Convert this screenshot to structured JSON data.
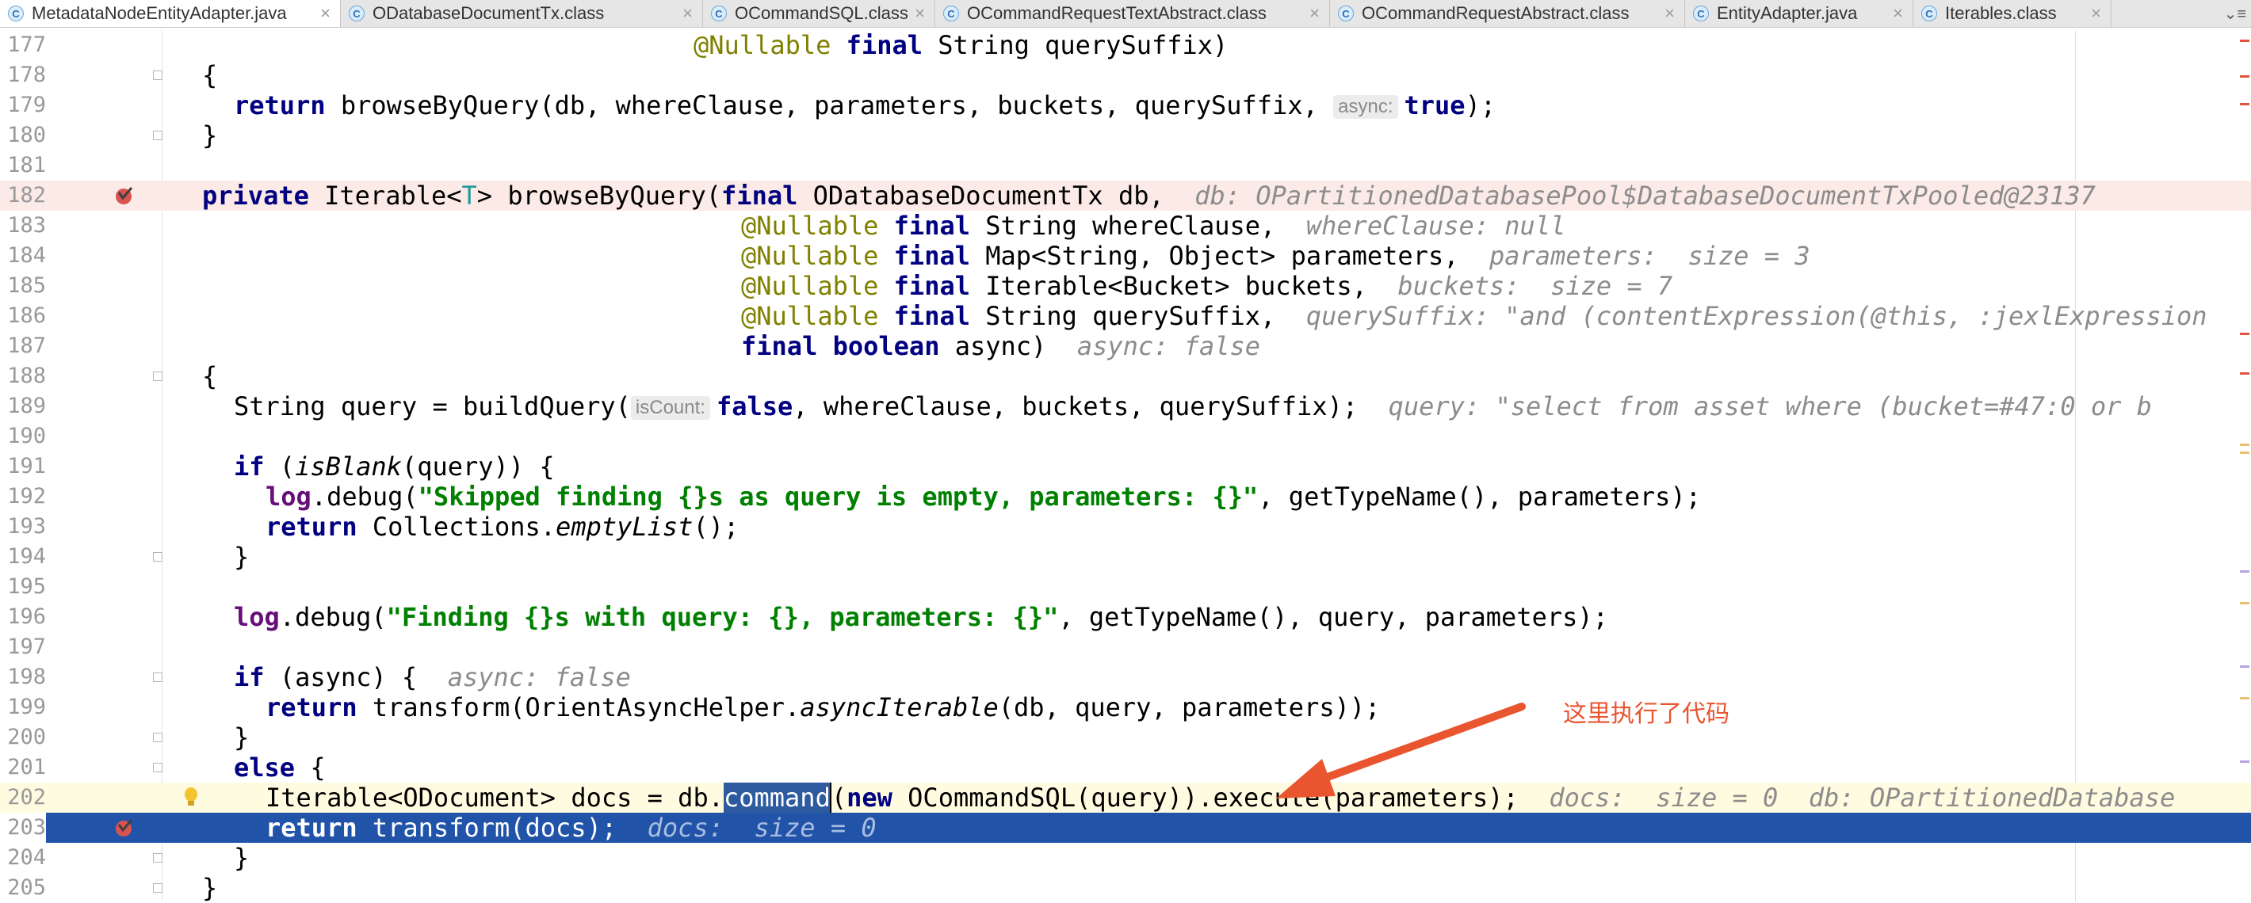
{
  "tabs": [
    {
      "label": "MetadataNodeEntityAdapter.java",
      "active": true
    },
    {
      "label": "ODatabaseDocumentTx.class",
      "active": false
    },
    {
      "label": "OCommandSQL.class",
      "active": false
    },
    {
      "label": "OCommandRequestTextAbstract.class",
      "active": false
    },
    {
      "label": "OCommandRequestAbstract.class",
      "active": false
    },
    {
      "label": "EntityAdapter.java",
      "active": false
    },
    {
      "label": "Iterables.class",
      "active": false
    }
  ],
  "tab_icon_letter": "C",
  "tab_close_glyph": "×",
  "tab_overflow": "⌄≡",
  "lines": {
    "n177": "177",
    "n178": "178",
    "n179": "179",
    "n180": "180",
    "n181": "181",
    "n182": "182",
    "n183": "183",
    "n184": "184",
    "n185": "185",
    "n186": "186",
    "n187": "187",
    "n188": "188",
    "n189": "189",
    "n190": "190",
    "n191": "191",
    "n192": "192",
    "n193": "193",
    "n194": "194",
    "n195": "195",
    "n196": "196",
    "n197": "197",
    "n198": "198",
    "n199": "199",
    "n200": "200",
    "n201": "201",
    "n202": "202",
    "n203": "203",
    "n204": "204",
    "n205": "205"
  },
  "code": {
    "l177_ann": "@Nullable",
    "l177_kw": "final",
    "l177_rest": " String querySuffix)",
    "brace_open": "{",
    "brace_close": "}",
    "l179_kw": "return",
    "l179_a": " browseByQuery(db, whereClause, parameters, buckets, querySuffix, ",
    "l179_inlay": "async:",
    "l179_true": "true",
    "l179_end": ");",
    "l182_kw1": "private",
    "l182_a": " Iterable<",
    "l182_T": "T",
    "l182_b": "> browseByQuery(",
    "l182_kw2": "final",
    "l182_c": " ODatabaseDocumentTx db,",
    "l182_hint": "db: OPartitionedDatabasePool$DatabaseDocumentTxPooled@23137",
    "p_ann": "@Nullable",
    "p_final": "final",
    "l183_rest": " String whereClause,",
    "l183_hint": "whereClause: null",
    "l184_rest": " Map<String, Object> parameters,",
    "l184_hint": "parameters:  size = 3",
    "l185_rest": " Iterable<Bucket> buckets,",
    "l185_hint": "buckets:  size = 7",
    "l186_rest": " String querySuffix,",
    "l186_hint": "querySuffix: \"and (contentExpression(@this, :jexlExpression",
    "l187_kw2": "boolean",
    "l187_rest": " async)",
    "l187_hint": "async: false",
    "l189_a": "String query = buildQuery(",
    "l189_inlay": "isCount:",
    "l189_false": "false",
    "l189_b": ", whereClause, buckets, querySuffix);",
    "l189_hint": "query: \"select from asset where (bucket=#47:0 or b",
    "l191_kw": "if",
    "l191_a": " (",
    "l191_m": "isBlank",
    "l191_b": "(query)) {",
    "log": "log",
    "l192_a": ".debug(",
    "l192_str": "\"Skipped finding {}s as query is empty, parameters: {}\"",
    "l192_b": ", getTypeName(), parameters);",
    "l193_kw": "return",
    "l193_a": " Collections.",
    "l193_m": "emptyList",
    "l193_b": "();",
    "l196_a": ".debug(",
    "l196_str": "\"Finding {}s with query: {}, parameters: {}\"",
    "l196_b": ", getTypeName(), query, parameters);",
    "l198_kw": "if",
    "l198_a": " (async) {",
    "l198_hint": "async: false",
    "l199_kw": "return",
    "l199_a": " transform(OrientAsyncHelper.",
    "l199_m": "asyncIterable",
    "l199_b": "(db, query, parameters));",
    "l201_kw": "else",
    "l201_a": " {",
    "l202_a": "Iterable<ODocument> docs = db.",
    "l202_sel": "command",
    "l202_b": "(",
    "l202_kw": "new",
    "l202_c": " OCommandSQL(query)).execute(parameters);",
    "l202_hint": "docs:  size = 0  db: OPartitionedDatabase",
    "l203_kw": "return",
    "l203_a": " transform(docs);",
    "l203_hint": "docs:  size = 0"
  },
  "annotation": {
    "text": "这里执行了代码",
    "color": "#e8552f"
  },
  "icons": {
    "breakpoint": "breakpoint-checked-icon",
    "bulb": "intention-bulb-icon",
    "fold": "fold-marker-icon"
  },
  "colors": {
    "exec_line": "#2154a8",
    "breakpoint_line": "#fbeae6",
    "current_line": "#fffbe0",
    "keyword": "#000080",
    "string": "#008000"
  }
}
